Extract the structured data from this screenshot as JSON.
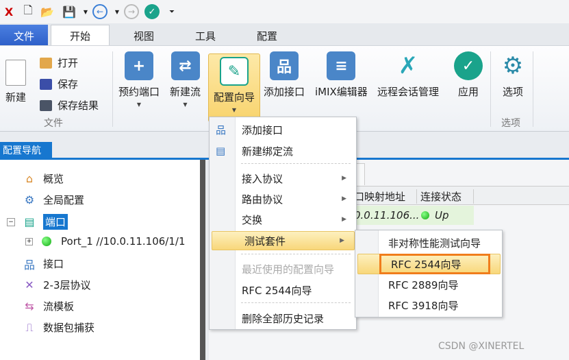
{
  "quick_access": {
    "icons": [
      "app-logo-icon",
      "new-file-icon",
      "open-folder-icon",
      "save-icon",
      "dropdown-icon",
      "back-icon",
      "dropdown-icon",
      "forward-icon",
      "apply-check-icon",
      "customize-icon"
    ]
  },
  "tabs": [
    {
      "label": "文件"
    },
    {
      "label": "开始"
    },
    {
      "label": "视图"
    },
    {
      "label": "工具"
    },
    {
      "label": "配置"
    }
  ],
  "ribbon": {
    "file_group": {
      "new": "新建",
      "open": "打开",
      "save": "保存",
      "save_results": "保存结果",
      "label": "文件"
    },
    "buttons": [
      {
        "label": "预约端口"
      },
      {
        "label": "新建流"
      },
      {
        "label": "配置向导"
      },
      {
        "label": "添加接口"
      },
      {
        "label": "iMIX编辑器"
      },
      {
        "label": "远程会话管理"
      },
      {
        "label": "应用"
      }
    ],
    "options": {
      "button": "选项",
      "label": "选项"
    }
  },
  "nav": {
    "title": "配置导航",
    "items": [
      {
        "label": "概览"
      },
      {
        "label": "全局配置"
      },
      {
        "label": "端口"
      },
      {
        "label": "Port_1 //10.0.11.106/1/1"
      },
      {
        "label": "接口"
      },
      {
        "label": "2-3层协议"
      },
      {
        "label": "流模板"
      },
      {
        "label": "数据包捕获"
      }
    ]
  },
  "table": {
    "headers": [
      "口映射地址",
      "连接状态"
    ],
    "row": [
      "0.0.11.106...",
      "Up"
    ]
  },
  "menu": {
    "items": [
      "添加接口",
      "新建绑定流",
      "接入协议",
      "路由协议",
      "交换",
      "测试套件",
      "最近使用的配置向导",
      "RFC 2544向导",
      "删除全部历史记录"
    ]
  },
  "submenu": {
    "items": [
      "非对称性能测试向导",
      "RFC 2544向导",
      "RFC 2889向导",
      "RFC 3918向导"
    ]
  },
  "watermark": "CSDN @XINERTEL",
  "colors": {
    "accent": "#1777cf",
    "highlight": "#f8d77a",
    "callout": "#f07d1c",
    "status_up": "#2db82d"
  }
}
